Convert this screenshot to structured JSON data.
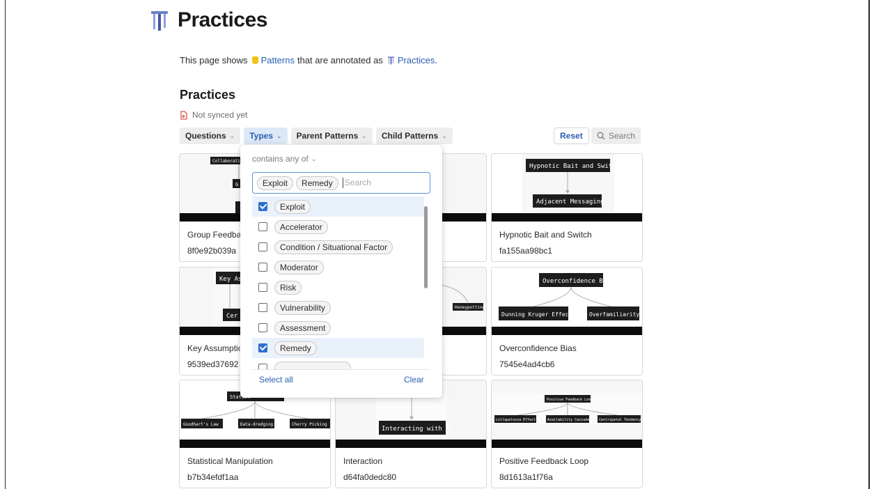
{
  "page": {
    "title": "Practices",
    "intro_prefix": "This page shows",
    "intro_link1": "Patterns",
    "intro_middle": "that are annotated as",
    "intro_link2": "Practices",
    "intro_suffix": "."
  },
  "section": {
    "title": "Practices",
    "sync_status": "Not synced yet"
  },
  "filters": {
    "chips": [
      {
        "label": "Questions"
      },
      {
        "label": "Types"
      },
      {
        "label": "Parent Patterns"
      },
      {
        "label": "Child Patterns"
      }
    ],
    "reset_label": "Reset",
    "search_label": "Search"
  },
  "dropdown": {
    "mode": "contains any of",
    "selected": [
      "Exploit",
      "Remedy"
    ],
    "search_placeholder": "Search",
    "options": [
      {
        "label": "Exploit",
        "checked": true
      },
      {
        "label": "Accelerator",
        "checked": false
      },
      {
        "label": "Condition / Situational Factor",
        "checked": false
      },
      {
        "label": "Moderator",
        "checked": false
      },
      {
        "label": "Risk",
        "checked": false
      },
      {
        "label": "Vulnerability",
        "checked": false
      },
      {
        "label": "Assessment",
        "checked": false
      },
      {
        "label": "Remedy",
        "checked": true
      }
    ],
    "select_all": "Select all",
    "clear": "Clear"
  },
  "cards": [
    {
      "title": "Group Feedba",
      "id": "8f0e92b039a",
      "thumb_labels": [
        "Collaboration",
        "G"
      ]
    },
    {
      "title": "",
      "id": "",
      "thumb_labels": []
    },
    {
      "title": "Hypnotic Bait and Switch",
      "id": "fa155aa98bc1",
      "thumb_labels": [
        "Hypnotic Bait and Switch",
        "Adjacent Messaging"
      ]
    },
    {
      "title": "Key Assumptio",
      "id": "9539ed37692",
      "thumb_labels": [
        "Key As",
        "Cer"
      ]
    },
    {
      "title": "",
      "id": "",
      "thumb_labels": [
        "Honeypotting"
      ]
    },
    {
      "title": "Overconfidence Bias",
      "id": "7545e4ad4cb6",
      "thumb_labels": [
        "Overconfidence Bias",
        "Dunning Kruger Effect",
        "Overfamiliarity"
      ]
    },
    {
      "title": "Statistical Manipulation",
      "id": "b7b34efdf1aa",
      "thumb_labels": [
        "Statist",
        "Goodhart's Law",
        "Data-dredging",
        "Cherry Picking"
      ]
    },
    {
      "title": "Interaction",
      "id": "d64fa0dedc80",
      "thumb_labels": [
        "Interacting with AI"
      ]
    },
    {
      "title": "Positive Feedback Loop",
      "id": "8d1613a1f76a",
      "thumb_labels": [
        "Positive Feedback Loop",
        "Lollapalooza Effect",
        "Availability Cascade",
        "Centripetal Tendency"
      ]
    }
  ]
}
